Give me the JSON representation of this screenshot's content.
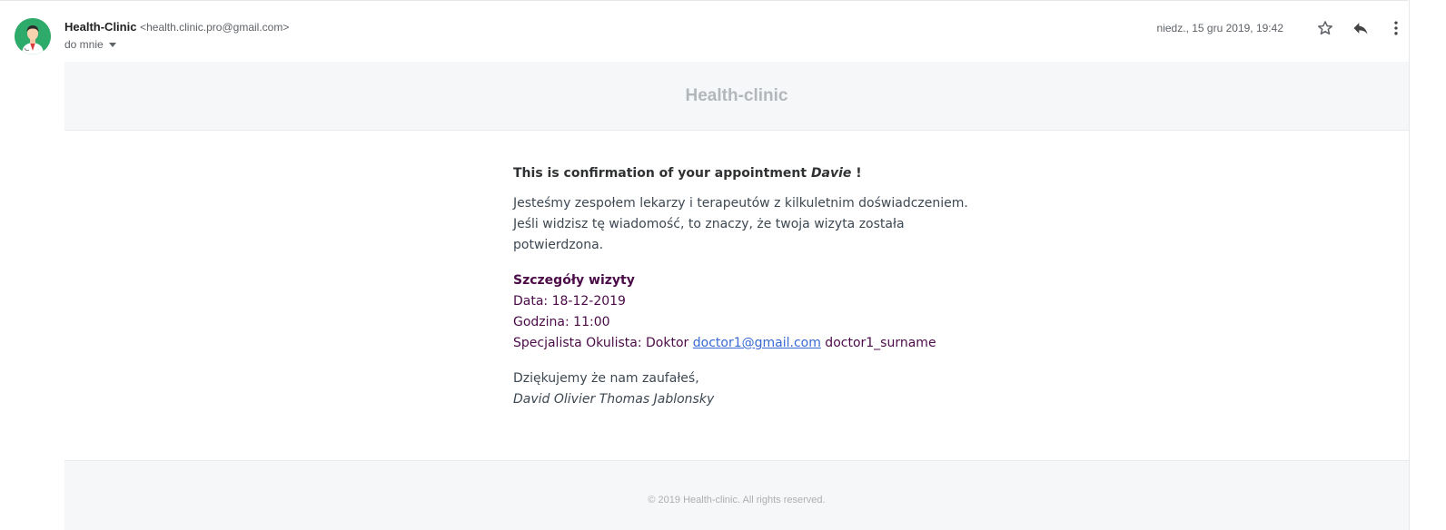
{
  "header": {
    "sender_name": "Health-Clinic",
    "sender_email": "<health.clinic.pro@gmail.com>",
    "recipient_label": "do mnie",
    "date": "niedz., 15 gru 2019, 19:42",
    "icons": {
      "star": "star-icon",
      "reply": "reply-icon",
      "more": "more-vert-icon",
      "dropdown": "chevron-down-icon",
      "avatar": "doctor-avatar-icon"
    }
  },
  "email": {
    "brand": "Health-clinic",
    "headline_text": "This is confirmation of your appointment ",
    "headline_name": "Davie",
    "headline_end": " !",
    "intro": "Jesteśmy zespołem lekarzy i terapeutów z kilkuletnim doświadczeniem. Jeśli widzisz tę wiadomość, to znaczy, że twoja wizyta została potwierdzona.",
    "details": {
      "title": "Szczegóły wizyty",
      "date": "Data: 18-12-2019",
      "time": "Godzina: 11:00",
      "specialist_prefix": "Specjalista Okulista: Doktor ",
      "doctor_email": "doctor1@gmail.com",
      "doctor_surname": " doctor1_surname"
    },
    "thanks": "Dziękujemy że nam zaufałeś,",
    "signature": "David Olivier Thomas Jablonsky",
    "footer": "© 2019 Health-clinic. All rights reserved."
  },
  "colors": {
    "avatar_bg": "#2eaa6a",
    "details_text": "#4b0a48",
    "link": "#3869d4",
    "band_bg": "#f5f7f9",
    "brand_text": "#b3b7bc"
  }
}
